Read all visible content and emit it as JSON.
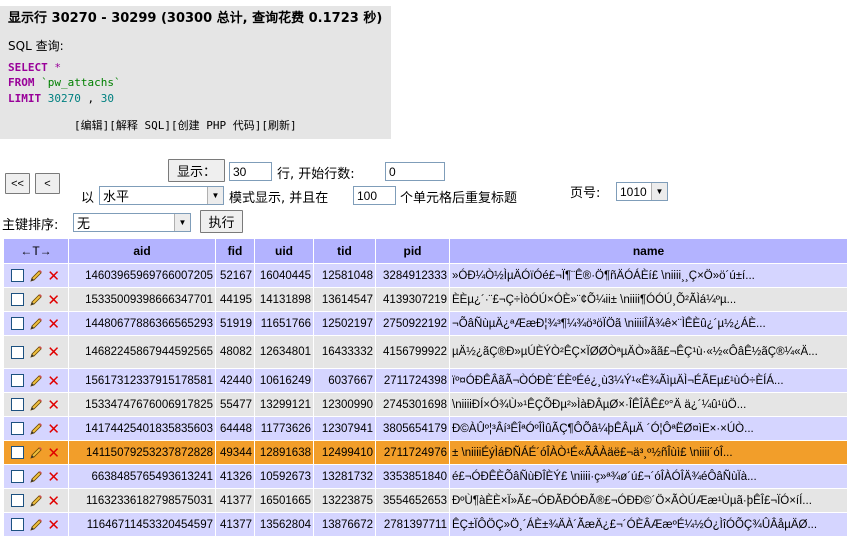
{
  "notice": {
    "title": "显示行 30270 - 30299 (30300 总计, 查询花费 0.1723 秒)",
    "sql_label": "SQL 查询:",
    "sql": {
      "select_kw": "SELECT",
      "select_rest": " *",
      "from_kw": "FROM",
      "table": " `pw_attachs`",
      "limit_kw": "LIMIT",
      "limit_offset": " 30270",
      "limit_sep": " , ",
      "limit_count": "30"
    },
    "links": "[编辑][解释 SQL][创建 PHP 代码][刷新]"
  },
  "nav": {
    "first_button": "<<",
    "prev_button": "<",
    "show_button": "显示：",
    "rows_value": "30",
    "rows_label": "行, 开始行数:",
    "start_value": "0",
    "mode_prefix": "以",
    "mode_value": "水平",
    "mode_suffix": "模式显示, 并且在",
    "repeat_value": "100",
    "repeat_suffix": "个单元格后重复标题",
    "page_label": "页号:",
    "page_value": "1010",
    "sort_label": "主键排序:",
    "sort_value": "无",
    "exec_button": "执行"
  },
  "table": {
    "arrow_header": "←T→",
    "columns": [
      "aid",
      "fid",
      "uid",
      "tid",
      "pid",
      "name"
    ],
    "rows": [
      {
        "aid": "14603965969766007205",
        "fid": "52167",
        "uid": "16040445",
        "tid": "12581048",
        "pid": "3284912333",
        "name": "»ÓÐ¼Ò½ÌµÄÓïÓé£¬Ï¶¨Ê®·Ö¶ñÄÓÁÈí£ \\niiii¸¸Ç×Ö»ö´ú±í..."
      },
      {
        "aid": "15335009398666347701",
        "fid": "44195",
        "uid": "14131898",
        "tid": "13614547",
        "pid": "4139307219",
        "name": "ÈÈµ¿´·¨£¬Ç÷ÌòÓÚ×ÓÈ»¨¢Õ¼ii± \\niiii¶ÓÓÚ¸Õ²ÃÌá¼ºµ..."
      },
      {
        "aid": "14480677886366565293",
        "fid": "51919",
        "uid": "11651766",
        "tid": "12502197",
        "pid": "2750922192",
        "name": "¬ÕâÑùµÄ¿ªÆæÐ¦¾³¶¼¾ö³öÏÖã \\niiiiÎÄ¾ê×¨ÌÊÈû¿´µ½¿ÁÈ..."
      },
      {
        "aid": "14682245867944592565",
        "fid": "48082",
        "uid": "12634801",
        "tid": "16433332",
        "pid": "4156799922",
        "name": "µÄ½¿ãÇ®Ð»µÚÈÝÒ²ÊÇ×ÏØØÒªµÄÒ»ãã£¬ÊÇ¹ù·«½«ÔâÊ½ãÇ®¼«Ä..."
      },
      {
        "aid": "15617312337915178581",
        "fid": "42440",
        "uid": "10616249",
        "tid": "6037667",
        "pid": "2711724398",
        "name": "ïº¤ÓÐÊÂãÃ¬ÒÓÐÈ´ÉÈºÉé¿¸ù3¼Ý¹«Ë¾ÃìµÄÌ¬ÉÃEµ£¹ùÓ÷ÈÍÁ..."
      },
      {
        "aid": "15334747676006917825",
        "fid": "55477",
        "uid": "13299121",
        "tid": "12300990",
        "pid": "2745301698",
        "name": "\\niiiiÐÍ×Ó¾Ù»¹ÊÇÕÐµ²»ÌàÐÂµØ×·ÎÊÎÂÊ£º°Ä ä¿´¼û¹üÖ..."
      },
      {
        "aid": "14174425401835835603",
        "fid": "64448",
        "uid": "11773626",
        "tid": "12307941",
        "pid": "3805654179",
        "name": "Ð©ÀÛº¦³Âí³ÊÎªÓºÎÌûÃÇ¶ÔÕâ¼þÊÂµÄ ´Ó¦ÔªËØ¤ìE×·×ÚÒ..."
      },
      {
        "aid": "14115079253237872828",
        "fid": "49344",
        "uid": "12891638",
        "tid": "12499410",
        "pid": "2711724976",
        "name": "± \\niiiiÉýÌáÐÑÁÉ´óÎÀÒ¹É«ÃÂÀäë£¬ä³¸º½ñÎùì£ \\niiii´óÎ..."
      },
      {
        "aid": "6638485765493613241",
        "fid": "41326",
        "uid": "10592673",
        "tid": "13281732",
        "pid": "3353851840",
        "name": "é£¬ÓÐÊÈÕâÑùÐÎÈÝ£ \\niiii·ç»ª¾ø´ú£¬´óÎÀÓÎÄ¾éÔâÑùÏà..."
      },
      {
        "aid": "11632336182798575031",
        "fid": "41377",
        "uid": "16501665",
        "tid": "13223875",
        "pid": "3554652653",
        "name": "ÐºÙ¶àÈÈ×Ï»Ã£¬ÓÐÃÐÓÐÃ®£¬ÓÐÐ©´Ö×ÃÒÚÆæ¹Ùµã·þÊÎ£¬ÏÓ×íÍ..."
      },
      {
        "aid": "11646711453320454597",
        "fid": "41377",
        "uid": "13562804",
        "tid": "13876672",
        "pid": "2781397711",
        "name": "ÊÇ±ÏÔÖÇ»Ö¸´ÁÈ±¾ÄÀ´ÃæÄ¿£¬´ÓÈÂÆæºÉ¼½Ó¿ÌîÓÕÇ¾ÛÂåµÄØ..."
      }
    ]
  }
}
